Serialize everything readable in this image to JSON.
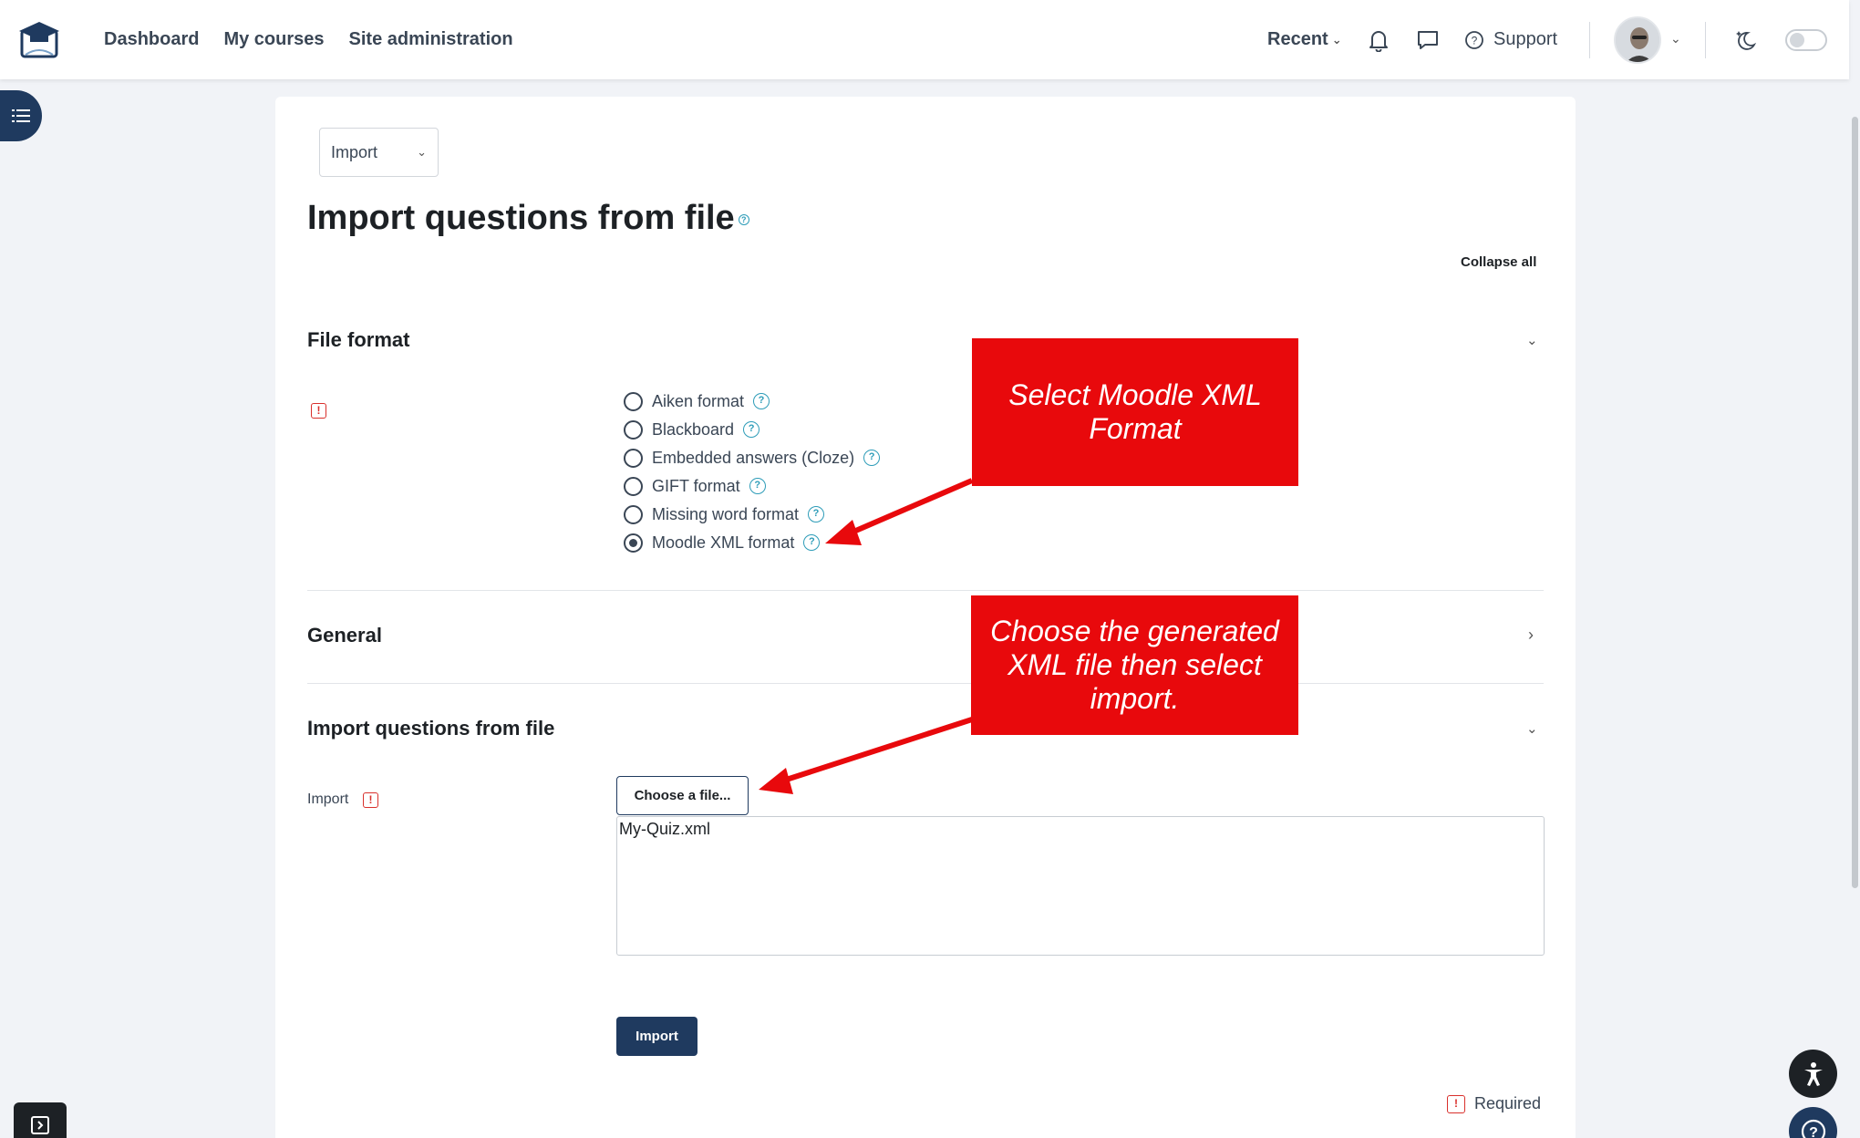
{
  "nav": {
    "links": [
      "Dashboard",
      "My courses",
      "Site administration"
    ],
    "recent_label": "Recent",
    "support_label": "Support"
  },
  "page": {
    "action_select": "Import",
    "title": "Import questions from file",
    "collapse_all": "Collapse all"
  },
  "file_format": {
    "heading": "File format",
    "options": [
      {
        "label": "Aiken format",
        "checked": false
      },
      {
        "label": "Blackboard",
        "checked": false
      },
      {
        "label": "Embedded answers (Cloze)",
        "checked": false
      },
      {
        "label": "GIFT format",
        "checked": false
      },
      {
        "label": "Missing word format",
        "checked": false
      },
      {
        "label": "Moodle XML format",
        "checked": true
      }
    ]
  },
  "general": {
    "heading": "General"
  },
  "import_section": {
    "heading": "Import questions from file",
    "field_label": "Import",
    "choose_button": "Choose a file...",
    "selected_file": "My-Quiz.xml",
    "submit_button": "Import",
    "required_note": "Required"
  },
  "annotations": {
    "callout1": "Select Moodle XML Format",
    "callout2": "Choose the generated XML file then select import."
  },
  "colors": {
    "primary": "#1f3a5f",
    "callout": "#e8090c",
    "help": "#2d9cb8",
    "required": "#d9302c"
  }
}
